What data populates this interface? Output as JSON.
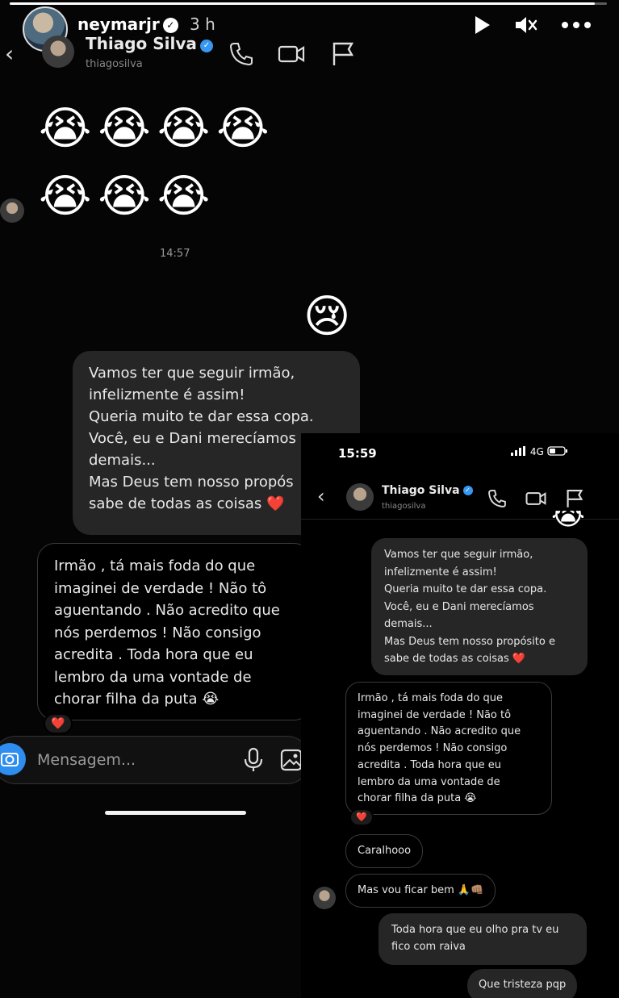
{
  "story": {
    "username": "neymarjr",
    "time": "3 h",
    "progress": 0.98
  },
  "chat": {
    "contact_name": "Thiago Silva",
    "contact_handle": "thiagosilva",
    "emoji_row_1": "😭😭😭😭",
    "emoji_row_2": "😭😭😭",
    "timestamp": "14:57",
    "sent_emoji": "😢",
    "sent_message": "Vamos ter que seguir irmão,\ninfelizmente é assim!\nQueria muito te dar essa copa.\nVocê, eu e Dani merecíamos\ndemais...\nMas Deus tem nosso propós\nsabe de todas as coisas ❤️",
    "received_message": "Irmão , tá mais foda do que\nimaginei de verdade ! Não tô\naguentando . Não acredito que\nnós perdemos ! Não consigo\nacredita . Toda hora que eu\nlembro da uma vontade de\nchorar filha da puta 😭",
    "reaction": "❤️",
    "composer_placeholder": "Mensagem..."
  },
  "overlay": {
    "status_time": "15:59",
    "status_network": "4G",
    "contact_name": "Thiago Silva",
    "contact_handle": "thiagosilva",
    "sent_message": "Vamos ter que seguir irmão,\ninfelizmente é assim!\nQueria muito te dar essa copa.\nVocê, eu e Dani merecíamos\ndemais...\nMas Deus tem nosso propósito e\nsabe de todas as coisas ❤️",
    "received_message": "Irmão , tá mais foda do que\nimaginei de verdade ! Não tô\naguentando . Não acredito que\nnós perdemos ! Não consigo\nacredita . Toda hora que eu\nlembro da uma vontade de\nchorar filha da puta 😭",
    "reaction": "❤️",
    "received_pill_1": "Caralhooo",
    "received_pill_2": "Mas vou ficar bem 🙏👊🏽",
    "sent_message_2": "Toda hora que eu olho pra tv eu\nfico com raiva",
    "sent_pill": "Que tristeza pqp"
  }
}
